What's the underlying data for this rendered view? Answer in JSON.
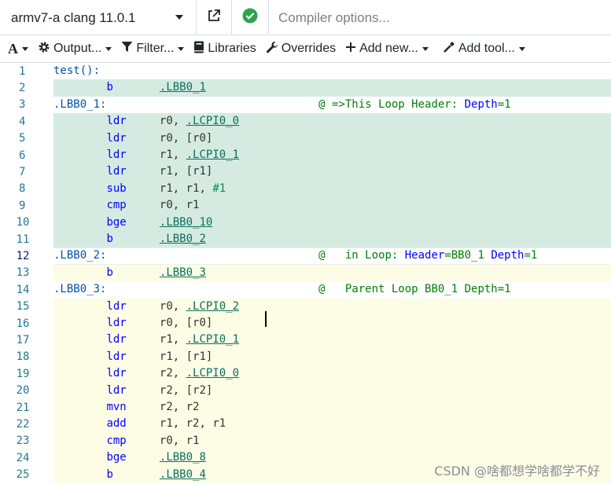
{
  "compiler": {
    "name": "armv7-a clang 11.0.1",
    "options_placeholder": "Compiler options..."
  },
  "toolbar": {
    "font_label": "A",
    "output_label": "Output...",
    "filter_label": "Filter...",
    "libraries_label": "Libraries",
    "overrides_label": "Overrides",
    "add_new_label": "Add new...",
    "add_tool_label": "Add tool..."
  },
  "editor": {
    "lines": [
      {
        "n": "1",
        "bg": "none",
        "html": [
          [
            "lbl",
            "test():"
          ]
        ]
      },
      {
        "n": "2",
        "bg": "green",
        "html": [
          [
            "",
            "        "
          ],
          [
            "mn",
            "b"
          ],
          [
            "",
            "       "
          ],
          [
            "lnk",
            ".LBB0_1"
          ]
        ]
      },
      {
        "n": "3",
        "bg": "none",
        "html": [
          [
            "lbl",
            ".LBB0_1:"
          ],
          [
            "",
            "                                "
          ],
          [
            "cmt",
            "@ =>This Loop Header: "
          ],
          [
            "cmt-kw",
            "Depth"
          ],
          [
            "cmt",
            "=1"
          ]
        ]
      },
      {
        "n": "4",
        "bg": "green",
        "html": [
          [
            "",
            "        "
          ],
          [
            "mn",
            "ldr"
          ],
          [
            "",
            "     "
          ],
          [
            "reg",
            "r0, "
          ],
          [
            "lnk",
            ".LCPI0_0"
          ]
        ]
      },
      {
        "n": "5",
        "bg": "green",
        "html": [
          [
            "",
            "        "
          ],
          [
            "mn",
            "ldr"
          ],
          [
            "",
            "     "
          ],
          [
            "reg",
            "r0, [r0]"
          ]
        ]
      },
      {
        "n": "6",
        "bg": "green",
        "html": [
          [
            "",
            "        "
          ],
          [
            "mn",
            "ldr"
          ],
          [
            "",
            "     "
          ],
          [
            "reg",
            "r1, "
          ],
          [
            "lnk",
            ".LCPI0_1"
          ]
        ]
      },
      {
        "n": "7",
        "bg": "green",
        "html": [
          [
            "",
            "        "
          ],
          [
            "mn",
            "ldr"
          ],
          [
            "",
            "     "
          ],
          [
            "reg",
            "r1, [r1]"
          ]
        ]
      },
      {
        "n": "8",
        "bg": "green",
        "html": [
          [
            "",
            "        "
          ],
          [
            "mn",
            "sub"
          ],
          [
            "",
            "     "
          ],
          [
            "reg",
            "r1, r1, "
          ],
          [
            "imm",
            "#1"
          ]
        ]
      },
      {
        "n": "9",
        "bg": "green",
        "html": [
          [
            "",
            "        "
          ],
          [
            "mn",
            "cmp"
          ],
          [
            "",
            "     "
          ],
          [
            "reg",
            "r0, r1"
          ]
        ]
      },
      {
        "n": "10",
        "bg": "green",
        "html": [
          [
            "",
            "        "
          ],
          [
            "mn",
            "bge"
          ],
          [
            "",
            "     "
          ],
          [
            "lnk",
            ".LBB0_10"
          ]
        ]
      },
      {
        "n": "11",
        "bg": "green",
        "html": [
          [
            "",
            "        "
          ],
          [
            "mn",
            "b"
          ],
          [
            "",
            "       "
          ],
          [
            "lnk",
            ".LBB0_2"
          ]
        ]
      },
      {
        "n": "12",
        "bg": "cur",
        "html": [
          [
            "lbl",
            ".LBB0_2:"
          ],
          [
            "",
            "                                "
          ],
          [
            "cmt",
            "@   in Loop: "
          ],
          [
            "cmt-kw",
            "Header"
          ],
          [
            "cmt",
            "=BB0_1 "
          ],
          [
            "cmt-kw",
            "Depth"
          ],
          [
            "cmt",
            "=1"
          ]
        ]
      },
      {
        "n": "13",
        "bg": "yellow",
        "html": [
          [
            "",
            "        "
          ],
          [
            "mn",
            "b"
          ],
          [
            "",
            "       "
          ],
          [
            "lnk",
            ".LBB0_3"
          ]
        ]
      },
      {
        "n": "14",
        "bg": "none",
        "html": [
          [
            "lbl",
            ".LBB0_3:"
          ],
          [
            "",
            "                                "
          ],
          [
            "cmt",
            "@   Parent Loop BB0_1 Depth=1"
          ]
        ]
      },
      {
        "n": "15",
        "bg": "yellow",
        "html": [
          [
            "",
            "        "
          ],
          [
            "mn",
            "ldr"
          ],
          [
            "",
            "     "
          ],
          [
            "reg",
            "r0, "
          ],
          [
            "lnk",
            ".LCPI0_2"
          ]
        ]
      },
      {
        "n": "16",
        "bg": "yellow",
        "html": [
          [
            "",
            "        "
          ],
          [
            "mn",
            "ldr"
          ],
          [
            "",
            "     "
          ],
          [
            "reg",
            "r0, [r0]"
          ]
        ]
      },
      {
        "n": "17",
        "bg": "yellow",
        "html": [
          [
            "",
            "        "
          ],
          [
            "mn",
            "ldr"
          ],
          [
            "",
            "     "
          ],
          [
            "reg",
            "r1, "
          ],
          [
            "lnk",
            ".LCPI0_1"
          ]
        ]
      },
      {
        "n": "18",
        "bg": "yellow",
        "html": [
          [
            "",
            "        "
          ],
          [
            "mn",
            "ldr"
          ],
          [
            "",
            "     "
          ],
          [
            "reg",
            "r1, [r1]"
          ]
        ]
      },
      {
        "n": "19",
        "bg": "yellow",
        "html": [
          [
            "",
            "        "
          ],
          [
            "mn",
            "ldr"
          ],
          [
            "",
            "     "
          ],
          [
            "reg",
            "r2, "
          ],
          [
            "lnk",
            ".LCPI0_0"
          ]
        ]
      },
      {
        "n": "20",
        "bg": "yellow",
        "html": [
          [
            "",
            "        "
          ],
          [
            "mn",
            "ldr"
          ],
          [
            "",
            "     "
          ],
          [
            "reg",
            "r2, [r2]"
          ]
        ]
      },
      {
        "n": "21",
        "bg": "yellow",
        "html": [
          [
            "",
            "        "
          ],
          [
            "mn",
            "mvn"
          ],
          [
            "",
            "     "
          ],
          [
            "reg",
            "r2, r2"
          ]
        ]
      },
      {
        "n": "22",
        "bg": "yellow",
        "html": [
          [
            "",
            "        "
          ],
          [
            "mn",
            "add"
          ],
          [
            "",
            "     "
          ],
          [
            "reg",
            "r1, r2, r1"
          ]
        ]
      },
      {
        "n": "23",
        "bg": "yellow",
        "html": [
          [
            "",
            "        "
          ],
          [
            "mn",
            "cmp"
          ],
          [
            "",
            "     "
          ],
          [
            "reg",
            "r0, r1"
          ]
        ]
      },
      {
        "n": "24",
        "bg": "yellow",
        "html": [
          [
            "",
            "        "
          ],
          [
            "mn",
            "bge"
          ],
          [
            "",
            "     "
          ],
          [
            "lnk",
            ".LBB0_8"
          ]
        ]
      },
      {
        "n": "25",
        "bg": "yellow",
        "html": [
          [
            "",
            "        "
          ],
          [
            "mn",
            "b"
          ],
          [
            "",
            "       "
          ],
          [
            "lnk",
            ".LBB0_4"
          ]
        ]
      }
    ]
  },
  "watermark": "CSDN @啥都想学啥都学不好",
  "colors": {
    "green_highlight": "#d5ebe2",
    "yellow_highlight": "#fdfde6",
    "status_ok": "#2ea44f"
  }
}
